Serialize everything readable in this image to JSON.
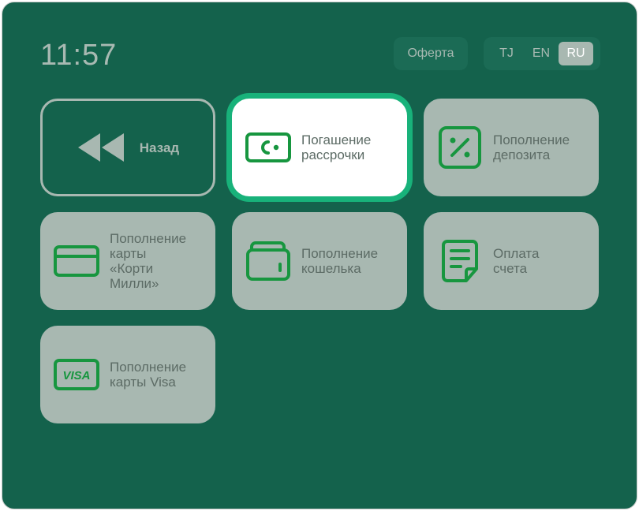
{
  "clock": "11:57",
  "offer_label": "Оферта",
  "languages": [
    {
      "code": "TJ",
      "active": false
    },
    {
      "code": "EN",
      "active": false
    },
    {
      "code": "RU",
      "active": true
    }
  ],
  "tiles": {
    "back": {
      "label": "Назад",
      "icon": "rewind-icon"
    },
    "installment": {
      "label": "Погашение\nрассрочки",
      "icon": "cash-note-icon"
    },
    "deposit": {
      "label": "Пополнение\nдепозита",
      "icon": "percent-icon"
    },
    "korti_milli": {
      "label": "Пополнение\nкарты\n«Корти\nМилли»",
      "icon": "card-icon"
    },
    "wallet": {
      "label": "Пополнение\nкошелька",
      "icon": "wallet-icon"
    },
    "bill": {
      "label": "Оплата\nсчета",
      "icon": "document-icon"
    },
    "visa": {
      "label": "Пополнение\nкарты Visa",
      "icon": "visa-icon",
      "logo_text": "VISA"
    }
  },
  "colors": {
    "background": "#14624c",
    "tile": "#a8b8b1",
    "icon_green": "#17963f",
    "highlight": "#18b27a"
  }
}
